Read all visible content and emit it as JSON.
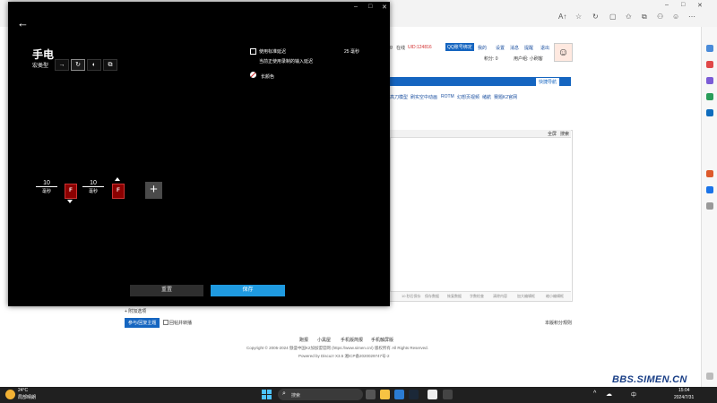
{
  "browser": {
    "window_controls": {
      "minimize": "–",
      "maximize": "□",
      "close": "✕"
    }
  },
  "forum": {
    "header": {
      "username_partial": "g",
      "online": "在线",
      "uid": "UID:124816",
      "qq_badge": "QQ账号绑定",
      "links": [
        "我的",
        "设置",
        "消息",
        "提醒",
        "退出"
      ],
      "points_label": "积分: 0",
      "usergroup_label": "用户组: 小刷客"
    },
    "quick_nav": "快捷导航",
    "subnav": [
      "高刀模型",
      "刷实空中动画",
      "ROTM",
      "幻想页视频",
      "绪航",
      "赛题K2官网"
    ],
    "post_header_links": [
      "全屏",
      "搜索"
    ],
    "editor_footer_items": [
      "10 秒后保存",
      "保存数据",
      "恢复数据",
      "字数检查",
      "清除内容",
      "加大编辑框",
      "缩小编辑框"
    ],
    "attach_toggle": "+ 附加选项",
    "submit_button": "参与/回复主题",
    "notify_label": "回帖并转播",
    "rules_link": "本版积分规则",
    "footer": {
      "links": [
        "跑报",
        "小黑屋",
        "手机版简报",
        "手机触屏版"
      ],
      "copyright": "Copyright © 2005-2024 傲盛中国K2加加盟官网 (https://www.simen.cn/) 版权所有 All Rights Reserved.",
      "powered": "Powered by Discuz! X3.5   湘ICP备2020029747号-2"
    }
  },
  "dialog": {
    "title": "手电",
    "type_label": "宏类型",
    "type_buttons": [
      "→",
      "↻",
      "◐",
      "⧉"
    ],
    "std_delay_label": "使用标准延迟",
    "std_delay_value": "25 毫秒",
    "std_delay_note": "当前正使用录制的输入延迟",
    "color_label": "长颜色",
    "sequence": [
      {
        "value": "10",
        "unit": "毫秒"
      },
      {
        "key": "F"
      },
      {
        "value": "10",
        "unit": "毫秒"
      },
      {
        "key": "F"
      }
    ],
    "add_label": "+",
    "reset_label": "重置",
    "save_label": "保存"
  },
  "taskbar": {
    "weather_temp": "24°C",
    "weather_desc": "局部晴朗",
    "search_label": "搜索",
    "tray_lang": "中",
    "clock_time": "15:04",
    "clock_date": "2024/7/31"
  },
  "watermark": "BBS.SIMEN.CN",
  "colors": {
    "dialog_bg": "#000000",
    "save_accent": "#1f9ae0",
    "key_box": "#8b0000",
    "forum_blue": "#1565c0",
    "taskbar": "#202020"
  }
}
